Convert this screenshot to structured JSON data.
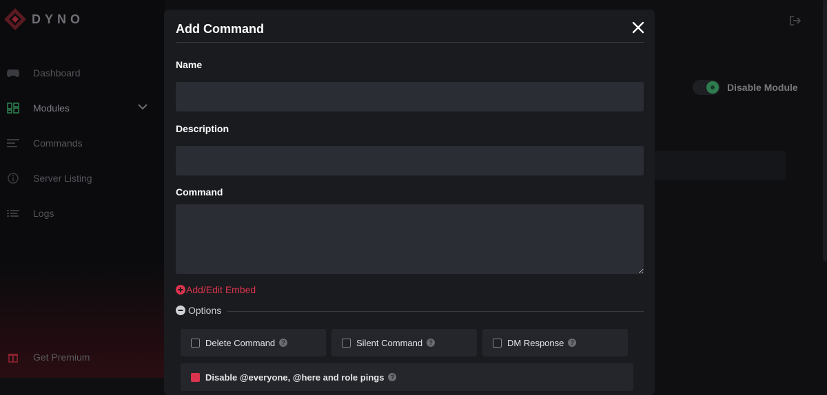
{
  "brand": {
    "name": "DYNO"
  },
  "sidebar": {
    "items": [
      {
        "label": "Dashboard",
        "icon": "gamepad-icon"
      },
      {
        "label": "Modules",
        "icon": "modules-icon"
      },
      {
        "label": "Commands",
        "icon": "commands-icon"
      },
      {
        "label": "Server Listing",
        "icon": "info-icon"
      },
      {
        "label": "Logs",
        "icon": "logs-icon"
      }
    ],
    "premium_label": "Get Premium"
  },
  "background": {
    "disable_module_label": "Disable Module"
  },
  "modal": {
    "title": "Add Command",
    "fields": {
      "name": {
        "label": "Name",
        "value": "",
        "placeholder": ""
      },
      "description": {
        "label": "Description",
        "value": "",
        "placeholder": ""
      },
      "command": {
        "label": "Command",
        "value": "",
        "placeholder": ""
      }
    },
    "embed_link": "Add/Edit Embed",
    "options_label": "Options",
    "options": [
      {
        "label": "Delete Command",
        "checked": false
      },
      {
        "label": "Silent Command",
        "checked": false
      },
      {
        "label": "DM Response",
        "checked": false
      }
    ],
    "partial_option": {
      "label": "Disable @everyone, @here and role pings",
      "checked": true
    }
  },
  "colors": {
    "accent": "#d9334d",
    "modal_bg": "#1a1b1f",
    "input_bg": "#2b2d34",
    "toggle_on": "#2e7d4f"
  }
}
